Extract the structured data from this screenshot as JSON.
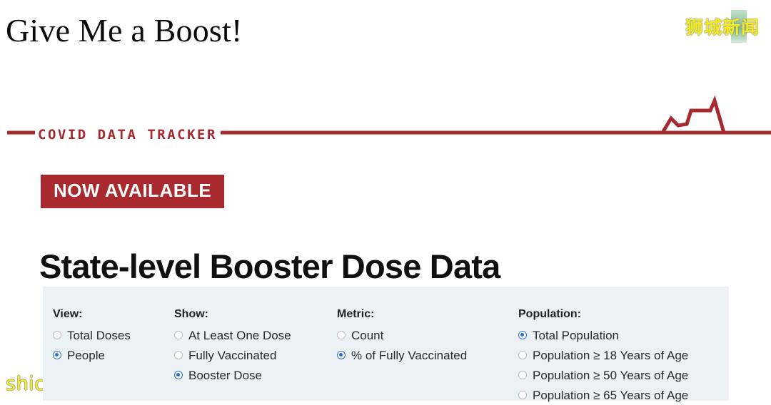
{
  "page": {
    "title": "Give Me a Boost!"
  },
  "watermarks": {
    "brand_cn": "狮城新闻",
    "site": "shicheng.news",
    "brand_color": "#f2ec1f",
    "accent_green": "#63ab78"
  },
  "tracker": {
    "label": "COVID DATA TRACKER",
    "line_color": "#a52a2f"
  },
  "promo": {
    "badge": "NOW AVAILABLE",
    "badge_bg": "#a8292e",
    "headline": "State-level Booster Dose Data"
  },
  "filters": {
    "panel_bg": "#ecf2f3",
    "selected_color": "#2f6fd0",
    "groups": [
      {
        "title": "View:",
        "options": [
          {
            "label": "Total Doses",
            "selected": false
          },
          {
            "label": "People",
            "selected": true
          }
        ]
      },
      {
        "title": "Show:",
        "options": [
          {
            "label": "At Least One Dose",
            "selected": false
          },
          {
            "label": "Fully Vaccinated",
            "selected": false
          },
          {
            "label": "Booster Dose",
            "selected": true
          }
        ]
      },
      {
        "title": "Metric:",
        "options": [
          {
            "label": "Count",
            "selected": false
          },
          {
            "label": "% of Fully Vaccinated",
            "selected": true
          }
        ]
      },
      {
        "title": "Population:",
        "options": [
          {
            "label": "Total Population",
            "selected": true
          },
          {
            "label": "Population ≥ 18 Years of Age",
            "selected": false
          },
          {
            "label": "Population ≥ 50 Years of Age",
            "selected": false
          },
          {
            "label": "Population ≥ 65 Years of Age",
            "selected": false
          }
        ]
      }
    ]
  }
}
